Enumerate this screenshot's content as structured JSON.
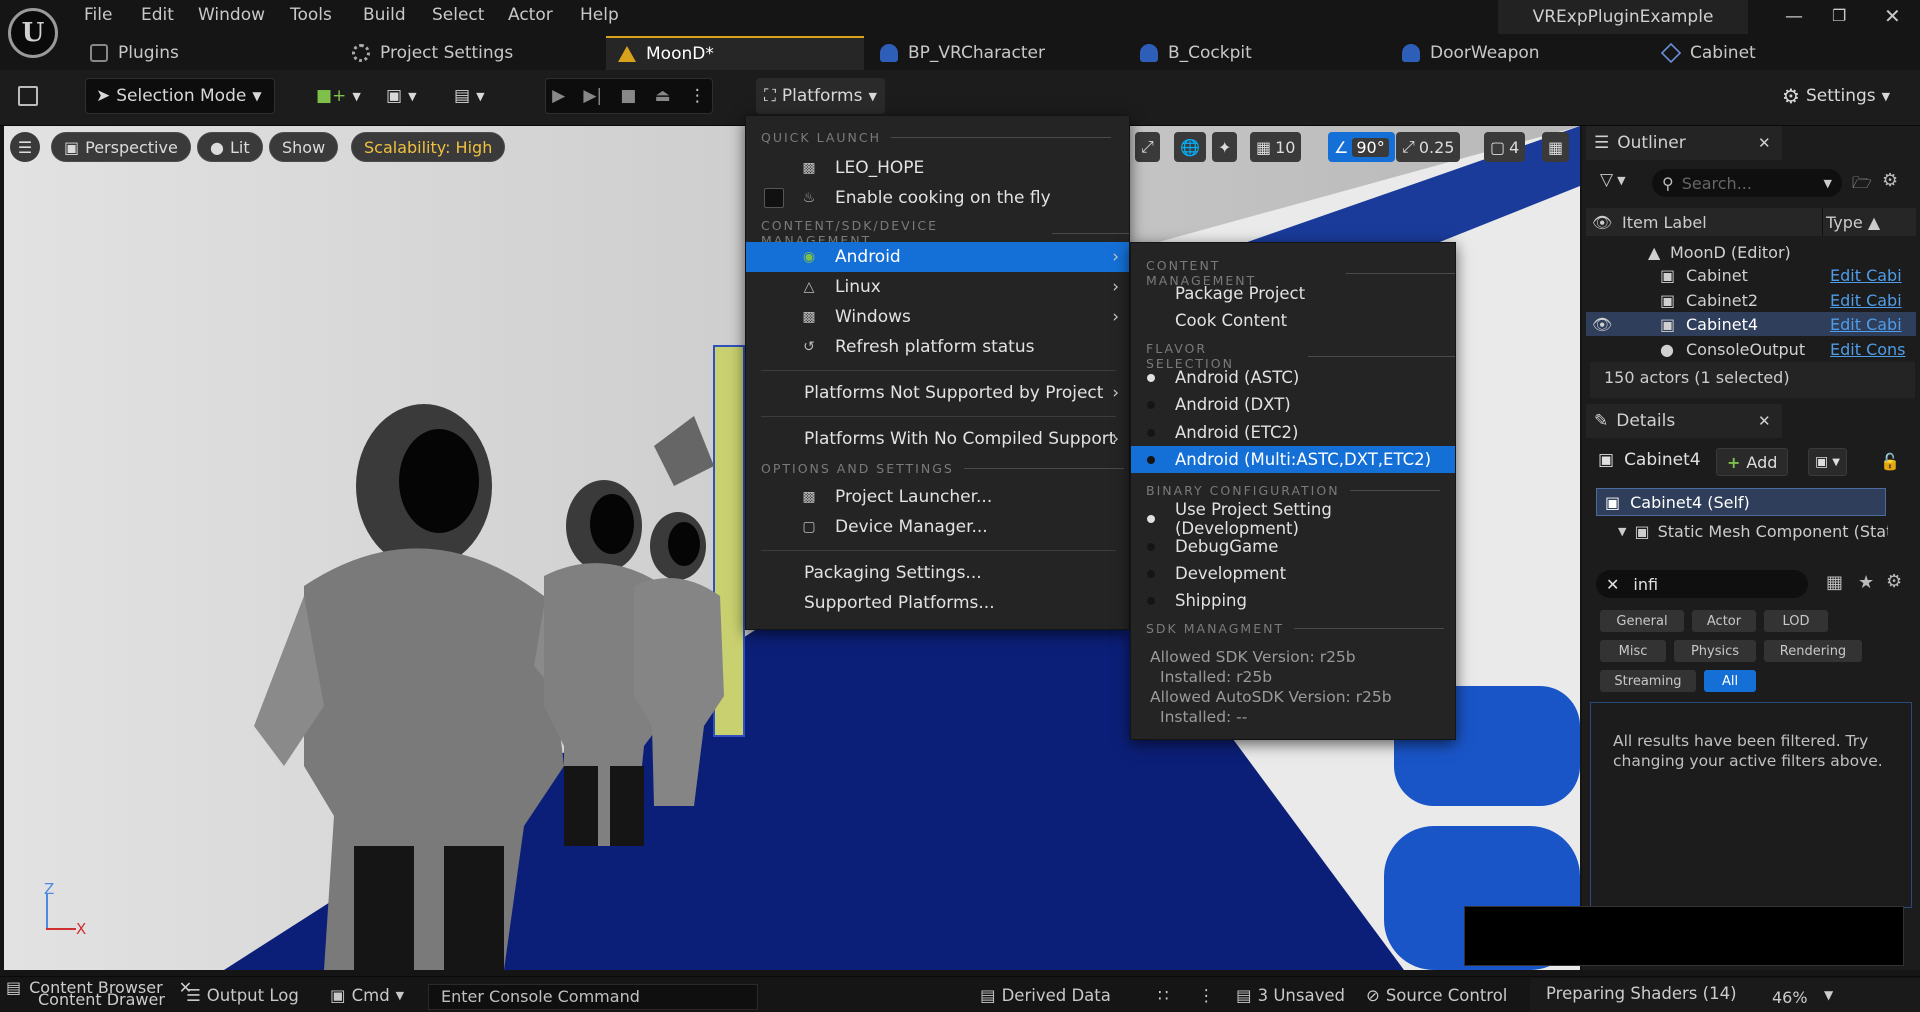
{
  "menubar": {
    "items": [
      "File",
      "Edit",
      "Window",
      "Tools",
      "Build",
      "Select",
      "Actor",
      "Help"
    ],
    "project_name": "VRExpPluginExample"
  },
  "tabs": [
    {
      "label": "Plugins"
    },
    {
      "label": "Project Settings"
    },
    {
      "label": "MoonD*"
    },
    {
      "label": "BP_VRCharacter"
    },
    {
      "label": "B_Cockpit"
    },
    {
      "label": "DoorWeapon"
    },
    {
      "label": "Cabinet"
    }
  ],
  "toolbar": {
    "selection_mode": "Selection Mode",
    "platforms": "Platforms",
    "settings": "Settings"
  },
  "viewport": {
    "perspective": "Perspective",
    "lit": "Lit",
    "show": "Show",
    "scalability": "Scalability: High",
    "grid_snap": "10",
    "rot_snap": "90°",
    "scale_snap": "0.25",
    "camera_speed": "4",
    "axis_z": "Z",
    "axis_x": "X"
  },
  "platforms_menu": {
    "quick_launch": "QUICK LAUNCH",
    "leo_hope": "LEO_HOPE",
    "cooking": "Enable cooking on the fly",
    "content_mgmt": "CONTENT/SDK/DEVICE MANAGEMENT",
    "android": "Android",
    "linux": "Linux",
    "windows": "Windows",
    "refresh": "Refresh platform status",
    "not_supported": "Platforms Not Supported by Project",
    "no_compiled": "Platforms With No Compiled Support",
    "options_settings": "OPTIONS AND SETTINGS",
    "project_launcher": "Project Launcher...",
    "device_manager": "Device Manager...",
    "packaging_settings": "Packaging Settings...",
    "supported_platforms": "Supported Platforms..."
  },
  "android_submenu": {
    "content_management": "CONTENT MANAGEMENT",
    "package_project": "Package Project",
    "cook_content": "Cook Content",
    "flavor_selection": "FLAVOR SELECTION",
    "flavors": [
      "Android (ASTC)",
      "Android (DXT)",
      "Android (ETC2)",
      "Android (Multi:ASTC,DXT,ETC2)"
    ],
    "binary_configuration": "BINARY CONFIGURATION",
    "configs": [
      "Use Project Setting (Development)",
      "DebugGame",
      "Development",
      "Shipping"
    ],
    "sdk_management": "SDK MANAGMENT",
    "sdk_lines": [
      "Allowed SDK Version: r25b",
      "Installed: r25b",
      "Allowed AutoSDK Version: r25b",
      "Installed: --"
    ]
  },
  "outliner": {
    "title": "Outliner",
    "search_placeholder": "Search...",
    "col_label": "Item Label",
    "col_type": "Type",
    "root": "MoonD (Editor)",
    "rows": [
      {
        "name": "Cabinet",
        "type": "Edit Cabi"
      },
      {
        "name": "Cabinet2",
        "type": "Edit Cabi"
      },
      {
        "name": "Cabinet4",
        "type": "Edit Cabi"
      },
      {
        "name": "ConsoleOutput",
        "type": "Edit Cons"
      }
    ],
    "count": "150 actors (1 selected)"
  },
  "details": {
    "title": "Details",
    "actor": "Cabinet4",
    "add": "Add",
    "self": "Cabinet4 (Self)",
    "component": "Static Mesh Component (Stat",
    "search_value": "infi",
    "filters": [
      "General",
      "Actor",
      "LOD",
      "Misc",
      "Physics",
      "Rendering",
      "Streaming",
      "All"
    ],
    "message": "All results have been filtered. Try changing your active filters above."
  },
  "statusbar": {
    "content_browser": "Content Browser",
    "content_drawer": "Content Drawer",
    "output_log": "Output Log",
    "cmd": "Cmd",
    "console_placeholder": "Enter Console Command",
    "derived_data": "Derived Data",
    "unsaved": "3 Unsaved",
    "source_control": "Source Control",
    "shaders": "Preparing Shaders (14)",
    "shader_pct": "46%"
  },
  "colors": {
    "accent": "#1470d6",
    "active_tab": "#d8a21c",
    "scalability": "#f0c040",
    "link": "#4f9de8"
  }
}
